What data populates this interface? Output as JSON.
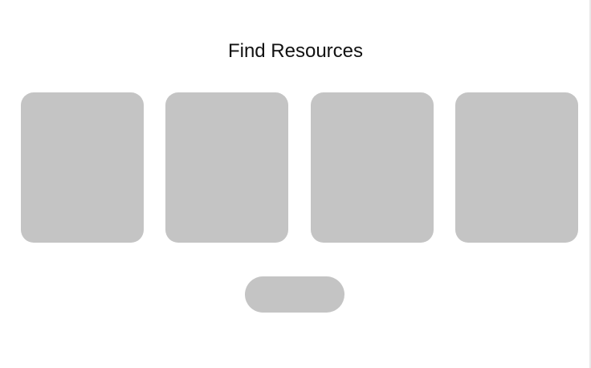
{
  "page": {
    "title": "Find Resources"
  },
  "cards": [
    {
      "label": ""
    },
    {
      "label": ""
    },
    {
      "label": ""
    },
    {
      "label": ""
    }
  ],
  "action_button": {
    "label": ""
  },
  "colors": {
    "background": "#ffffff",
    "placeholder_fill": "#c4c4c4",
    "title_text": "#111111",
    "right_edge": "#e9e9e9"
  }
}
